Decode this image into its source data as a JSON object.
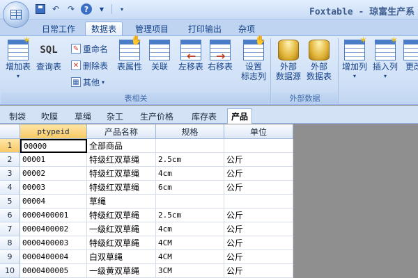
{
  "app": {
    "title": "Foxtable - 琼富生产系"
  },
  "ribbon_tabs": [
    "日常工作",
    "数据表",
    "管理项目",
    "打印输出",
    "杂项"
  ],
  "ribbon": {
    "table_group": {
      "label": "表相关",
      "add_table": "增加表",
      "query_table": "查询表",
      "sql_text": "SQL",
      "rename": "重命名",
      "delete_table": "删除表",
      "other": "其他",
      "table_props": "表属性",
      "relations": "关联",
      "move_left": "左移表",
      "move_right": "右移表",
      "set_label_col_1": "设置",
      "set_label_col_2": "标志列"
    },
    "external_group": {
      "label": "外部数据",
      "ext_source_1": "外部",
      "ext_source_2": "数据源",
      "ext_table_1": "外部",
      "ext_table_2": "数据表"
    },
    "column_group": {
      "add_column": "增加列",
      "insert_column": "插入列",
      "change_column": "更改"
    }
  },
  "table_tabs": [
    "制袋",
    "吹膜",
    "草绳",
    "杂工",
    "生产价格",
    "库存表",
    "产品"
  ],
  "grid": {
    "columns": [
      "ptypeid",
      "产品名称",
      "规格",
      "单位"
    ],
    "rows": [
      [
        "1",
        "00000",
        "全部商品",
        "",
        ""
      ],
      [
        "2",
        "00001",
        "特级红双草绳",
        "2.5cm",
        "公斤"
      ],
      [
        "3",
        "00002",
        "特级红双草绳",
        "4cm",
        "公斤"
      ],
      [
        "4",
        "00003",
        "特级红双草绳",
        "6cm",
        "公斤"
      ],
      [
        "5",
        "00004",
        "草绳",
        "",
        ""
      ],
      [
        "6",
        "0000400001",
        "特级红双草绳",
        "2.5cm",
        "公斤"
      ],
      [
        "7",
        "0000400002",
        "一级红双草绳",
        "4cm",
        "公斤"
      ],
      [
        "8",
        "0000400003",
        "特级红双草绳",
        "4CM",
        "公斤"
      ],
      [
        "9",
        "0000400004",
        "白双草绳",
        "4CM",
        "公斤"
      ],
      [
        "10",
        "0000400005",
        "一级黄双草绳",
        "3CM",
        "公斤"
      ]
    ]
  }
}
